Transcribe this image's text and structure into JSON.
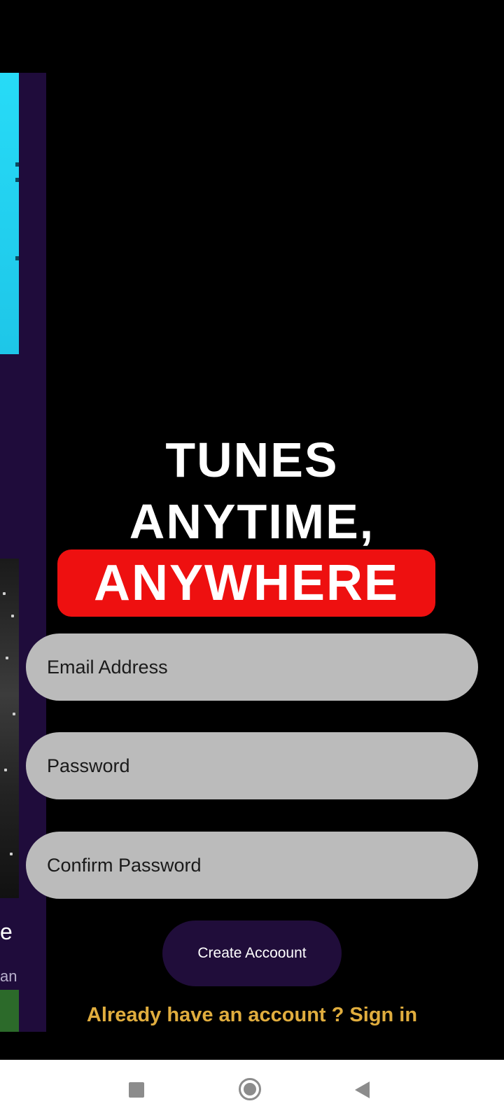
{
  "hero": {
    "line1": "TUNES",
    "line2": "ANYTIME,",
    "line3": "ANYWHERE"
  },
  "form": {
    "email_placeholder": "Email Address",
    "password_placeholder": "Password",
    "confirm_placeholder": "Confirm Password",
    "create_button": "Create Accoount",
    "signin_link": "Already have an account ? Sign in"
  },
  "background": {
    "partial_title": "e",
    "partial_subtitle": "an"
  },
  "colors": {
    "background": "#000000",
    "hero_highlight": "#ee1010",
    "field_fill": "#bbbbbb",
    "button_fill": "#200d3a",
    "link_color": "#e0ad3e",
    "side_panel": "#1f0c3b"
  },
  "navbar": {
    "icons": [
      "recent-apps-icon",
      "home-icon",
      "back-icon"
    ]
  }
}
